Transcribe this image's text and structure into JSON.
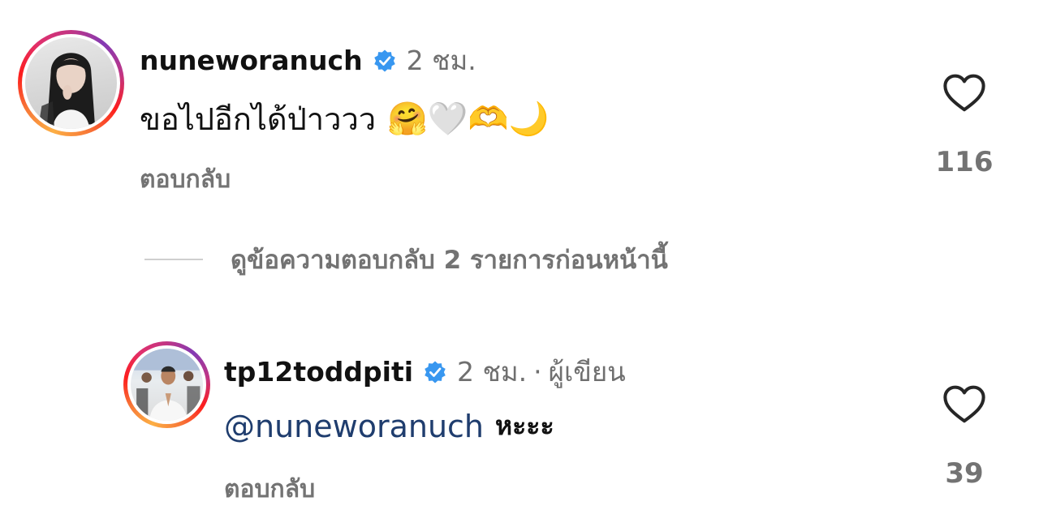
{
  "comments": [
    {
      "username": "nuneworanuch",
      "time": "2 ชม.",
      "text": "ขอไปอีกได้ป่าววว",
      "emojis": "🤗🤍🫶🌙",
      "reply_label": "ตอบกลับ",
      "likes": "116",
      "avatar_icon": "profile-photo-woman"
    },
    {
      "username": "tp12toddpiti",
      "time": "2 ชม.",
      "separator": "·",
      "author_badge": "ผู้เขียน",
      "mention": "@nuneworanuch",
      "text": "หะะะ",
      "reply_label": "ตอบกลับ",
      "likes": "39",
      "avatar_icon": "profile-photo-man"
    }
  ],
  "view_replies": {
    "label": "ดูข้อความตอบกลับ 2 รายการก่อนหน้านี้"
  },
  "colors": {
    "verified_badge": "#3897f0",
    "mention": "#1f3d6e",
    "secondary_text": "#737373"
  }
}
